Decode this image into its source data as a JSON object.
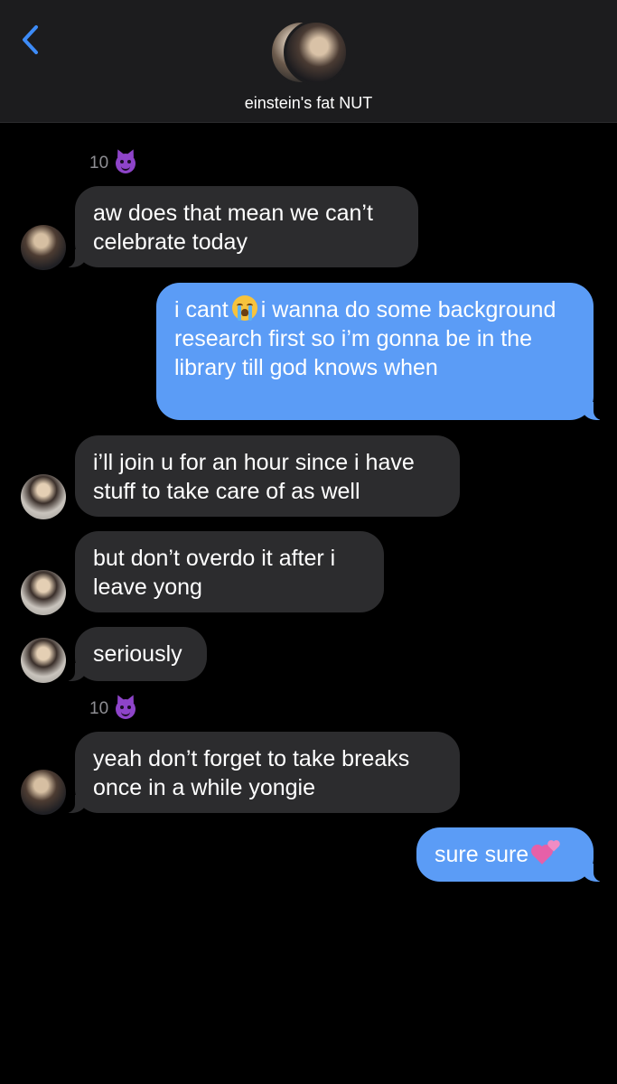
{
  "header": {
    "back_icon": "chevron-left-icon",
    "group_name": "einstein's fat NUT",
    "accent_color": "#3d8bf7"
  },
  "messages": [
    {
      "kind": "timestamp",
      "text": "10",
      "icon": "smiling-devil-icon"
    },
    {
      "kind": "incoming",
      "avatar": "dark",
      "text": "aw does that mean we can’t celebrate today"
    },
    {
      "kind": "outgoing",
      "text_before_emoji": "i cant",
      "emoji": "sob-icon",
      "text_after_emoji": "i wanna do some background research first so i’m gonna be in the library till god knows when"
    },
    {
      "kind": "incoming",
      "avatar": "light",
      "text": "i’ll join u for an hour since i have stuff to take care of as well"
    },
    {
      "kind": "incoming",
      "avatar": "light",
      "text": "but don’t overdo it after i leave yong"
    },
    {
      "kind": "incoming",
      "avatar": "light",
      "text": "seriously"
    },
    {
      "kind": "timestamp",
      "text": "10",
      "icon": "smiling-devil-icon"
    },
    {
      "kind": "incoming",
      "avatar": "dark",
      "text": "yeah don’t forget to take breaks once in a while yongie"
    },
    {
      "kind": "outgoing",
      "text": "sure sure",
      "emoji": "two-hearts-icon"
    }
  ],
  "colors": {
    "incoming_bubble": "#2c2c2e",
    "outgoing_bubble": "#5b9cf6",
    "background": "#000000"
  }
}
